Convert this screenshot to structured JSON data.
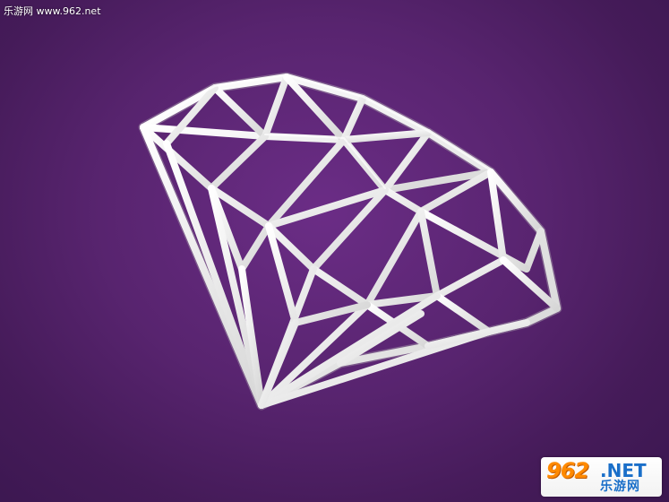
{
  "scene": {
    "background_color": "#5a2573",
    "wireframe_color": "#e9e9e9",
    "object": "diamond-wireframe"
  },
  "watermark": {
    "text": "乐游网 www.962.net"
  },
  "logo": {
    "number": "962",
    "domain": ".NET",
    "subtitle": "乐游网",
    "accent_orange": "#ff8a00",
    "accent_blue": "#1a6fc9"
  }
}
